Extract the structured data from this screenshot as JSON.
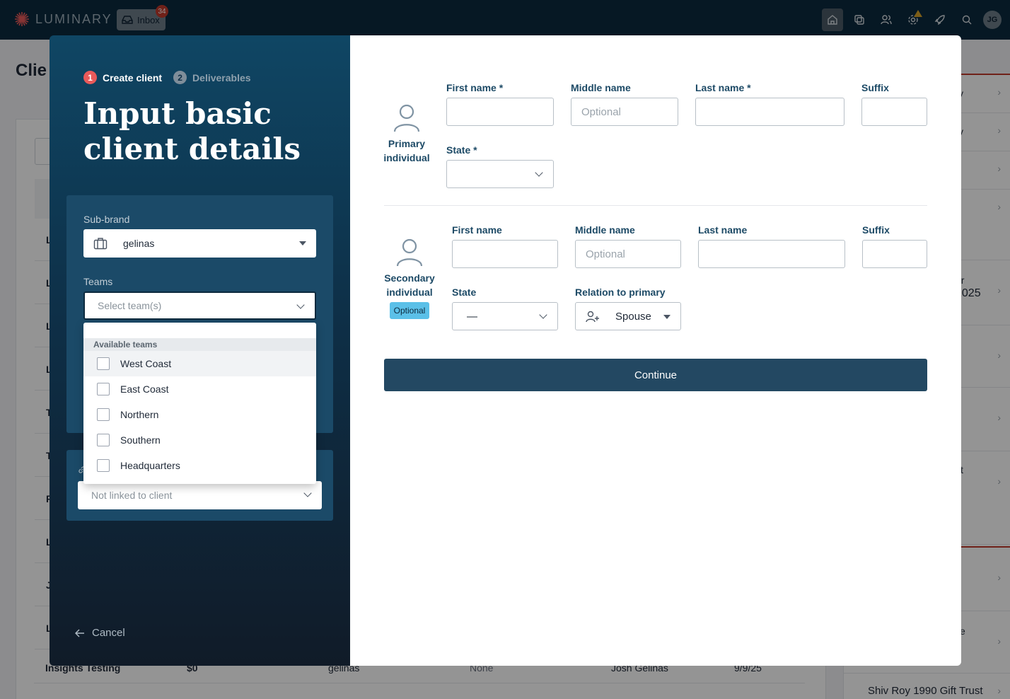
{
  "topbar": {
    "brand": "LUMINARY",
    "inbox_label": "Inbox",
    "inbox_count": "34",
    "nav_icons": [
      "home-icon",
      "layers-icon",
      "users-icon",
      "gear-icon",
      "rocket-icon",
      "search-icon"
    ],
    "avatar_initials": "JG",
    "colors": {
      "bar": "#0c2a3e",
      "accent": "#e95a5a"
    }
  },
  "background": {
    "page_title": "Clie",
    "row_initials": [
      "L",
      "L",
      "L",
      "L",
      "T",
      "T",
      "F",
      "L",
      "J",
      "L"
    ],
    "last_row": {
      "name": "Insights Testing",
      "value": "$0",
      "brand": "gelinas",
      "teams": "None",
      "owner": "Josh Gelinas",
      "date": "9/9/25"
    },
    "right_panel": {
      "fragments": [
        "y",
        "y",
        "er",
        "2025",
        "st",
        "e"
      ],
      "last_item": "Shiv Roy 1990 Gift Trust"
    }
  },
  "modal": {
    "steps": [
      {
        "num": "1",
        "label": "Create client"
      },
      {
        "num": "2",
        "label": "Deliverables"
      }
    ],
    "title": "Input basic client details",
    "subbrand": {
      "label": "Sub-brand",
      "value": "gelinas"
    },
    "teams": {
      "label": "Teams",
      "placeholder": "Select team(s)",
      "dropdown_header": "Available teams",
      "options": [
        "West Coast",
        "East Coast",
        "Northern",
        "Southern",
        "Headquarters"
      ]
    },
    "linked_client": {
      "placeholder": "Not linked to client"
    },
    "cancel_label": "Cancel",
    "primary": {
      "heading": "Primary individual",
      "first_name_label": "First name *",
      "middle_name_label": "Middle name",
      "middle_name_placeholder": "Optional",
      "last_name_label": "Last name *",
      "suffix_label": "Suffix",
      "state_label": "State *"
    },
    "secondary": {
      "heading": "Secondary individual",
      "optional_badge": "Optional",
      "first_name_label": "First name",
      "middle_name_label": "Middle name",
      "middle_name_placeholder": "Optional",
      "last_name_label": "Last name",
      "suffix_label": "Suffix",
      "state_label": "State",
      "state_value": "—",
      "relation_label": "Relation to primary",
      "relation_value": "Spouse"
    },
    "continue_label": "Continue"
  }
}
